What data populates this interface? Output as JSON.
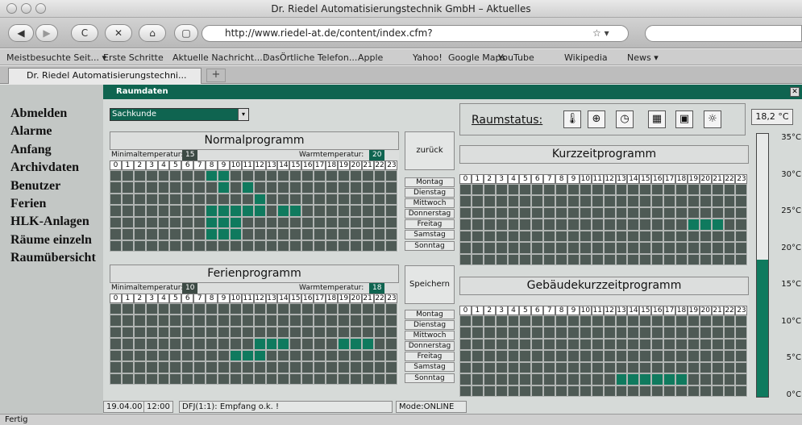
{
  "window": {
    "title": "Dr. Riedel Automatisierungstechnik GmbH – Aktuelles",
    "status": "Fertig"
  },
  "toolbar": {
    "url": "http://www.riedel-at.de/content/index.cfm?",
    "back": "◀",
    "forward": "▶",
    "reload": "C",
    "stop": "✕",
    "home": "⌂",
    "star": "☆ ▾"
  },
  "bookmarks": [
    "Meistbesuchte Seit... ▾",
    "Erste Schritte",
    "Aktuelle Nachricht... ᵎ",
    "DasÖrtliche Telefon...",
    "Apple",
    "Yahoo!",
    "Google Maps",
    "YouTube",
    "Wikipedia",
    "News ▾"
  ],
  "tab": {
    "label": "Dr. Riedel Automatisierungstechni...",
    "new": "+"
  },
  "nav": [
    "Abmelden",
    "Alarme",
    "Anfang",
    "Archivdaten",
    "Benutzer",
    "Ferien",
    "HLK-Anlagen",
    "Räume einzeln",
    "Raumübersicht"
  ],
  "panel": {
    "title": "Raumdaten",
    "close": "✕",
    "room": "Sachkunde",
    "room_arrow": "▾"
  },
  "hours": [
    "0",
    "1",
    "2",
    "3",
    "4",
    "5",
    "6",
    "7",
    "8",
    "9",
    "10",
    "11",
    "12",
    "13",
    "14",
    "15",
    "16",
    "17",
    "18",
    "19",
    "20",
    "21",
    "22",
    "23"
  ],
  "days": [
    "Montag",
    "Dienstag",
    "Mittwoch",
    "Donnerstag",
    "Freitag",
    "Samstag",
    "Sonntag"
  ],
  "buttons": {
    "back": "zurück",
    "save": "Speichern"
  },
  "programs": [
    {
      "title": "Normalprogramm",
      "min_label": "Minimaltemperatur:",
      "min_value": "15",
      "warm_label": "Warmtemperatur:",
      "warm_value": "20",
      "on": [
        [
          8,
          9
        ],
        [
          9,
          11
        ],
        [
          12
        ],
        [
          8,
          9,
          10,
          11,
          12,
          14,
          15
        ],
        [
          8,
          9,
          10
        ],
        [
          8,
          9,
          10
        ],
        []
      ]
    },
    {
      "title": "Ferienprogramm",
      "min_label": "Minimaltemperatur:",
      "min_value": "10",
      "warm_label": "Warmtemperatur:",
      "warm_value": "18",
      "on": [
        [],
        [],
        [],
        [
          12,
          13,
          14,
          19,
          20,
          21
        ],
        [
          10,
          11,
          12
        ],
        [],
        []
      ]
    },
    {
      "title": "Kurzzeitprogramm",
      "on": [
        [],
        [],
        [],
        [
          19,
          20,
          21
        ],
        [],
        [],
        []
      ]
    },
    {
      "title": "Gebäudekurzzeitprogramm",
      "on": [
        [],
        [],
        [],
        [],
        [],
        [
          13,
          14,
          15,
          16,
          17,
          18
        ],
        []
      ]
    }
  ],
  "raumstatus": {
    "label": "Raumstatus:",
    "icons": [
      "thermometer-icon",
      "valve-icon",
      "clock-icon",
      "window-icon",
      "display-icon",
      "light-icon"
    ],
    "glyphs": [
      "🌡",
      "⊕",
      "◷",
      "▦",
      "▣",
      "☼"
    ]
  },
  "thermometer": {
    "reading": "18,2 °C",
    "scale": [
      "35°C",
      "30°C",
      "25°C",
      "20°C",
      "15°C",
      "10°C",
      "5°C",
      "0°C"
    ],
    "level_c": 18.2,
    "max_c": 35
  },
  "statusbar": {
    "date": "19.04.00",
    "time": "12:00",
    "message": "DFJ(1:1): Empfang o.k. !",
    "mode": "Mode:ONLINE"
  }
}
